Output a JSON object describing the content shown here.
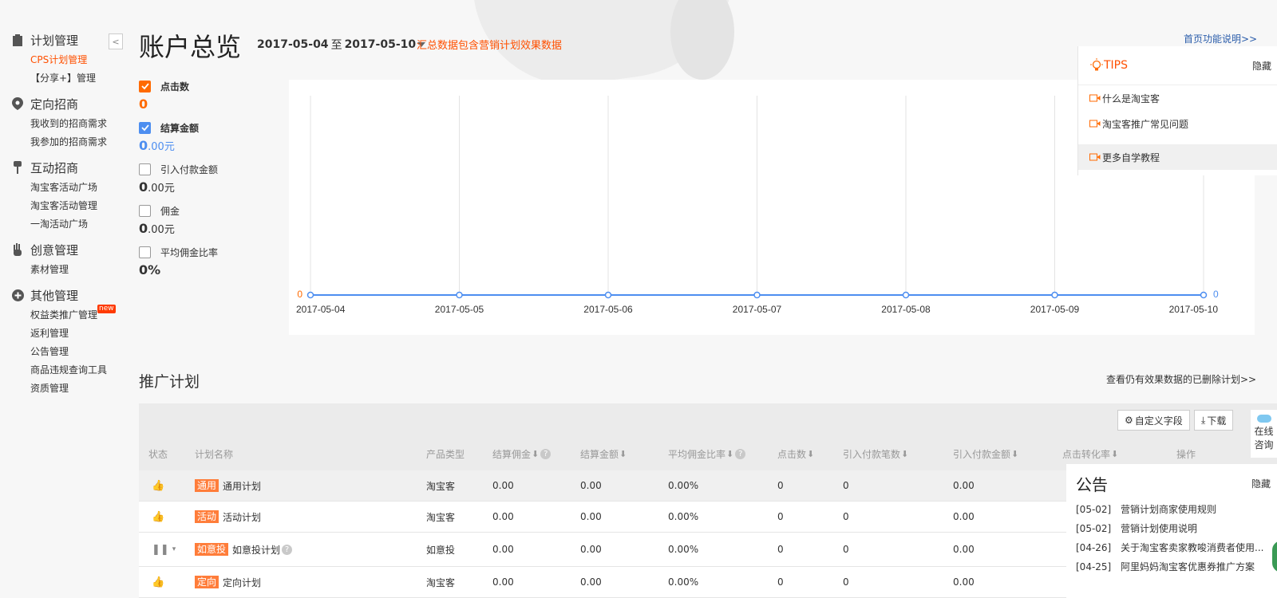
{
  "page": {
    "title": "账户总览",
    "date_from": "2017-05-04",
    "date_sep": "至",
    "date_to": "2017-05-10",
    "note": "汇总数据包含营销计划效果数据",
    "help_link": "首页功能说明>>"
  },
  "sidebar": {
    "collapse": "<",
    "sections": [
      {
        "title": "计划管理",
        "icon": "clipboard-icon",
        "items": [
          {
            "label": "CPS计划管理",
            "active": true
          },
          {
            "label": "【分享+】管理"
          }
        ]
      },
      {
        "title": "定向招商",
        "icon": "location-pin-icon",
        "items": [
          {
            "label": "我收到的招商需求"
          },
          {
            "label": "我参加的招商需求"
          }
        ]
      },
      {
        "title": "互动招商",
        "icon": "pushpin-icon",
        "items": [
          {
            "label": "淘宝客活动广场"
          },
          {
            "label": "淘宝客活动管理"
          },
          {
            "label": "一淘活动广场"
          }
        ]
      },
      {
        "title": "创意管理",
        "icon": "hand-icon",
        "items": [
          {
            "label": "素材管理"
          }
        ]
      },
      {
        "title": "其他管理",
        "icon": "plus-circle-icon",
        "items": [
          {
            "label": "权益类推广管理",
            "badge": "new"
          },
          {
            "label": "返利管理"
          },
          {
            "label": "公告管理"
          },
          {
            "label": "商品违规查询工具"
          },
          {
            "label": "资质管理"
          }
        ]
      }
    ]
  },
  "metrics": [
    {
      "label": "点击数",
      "checked": true,
      "check_color": "#ff6a00",
      "value": "0",
      "unit": "",
      "value_color": "#ff6a00",
      "bold_label": true
    },
    {
      "label": "结算金额",
      "checked": true,
      "check_color": "#4d8ef0",
      "value": "0",
      "unit": ".00元",
      "value_color": "#4d8ef0",
      "bold_label": true
    },
    {
      "label": "引入付款金额",
      "checked": false,
      "value": "0",
      "unit": ".00元",
      "value_color": "#222"
    },
    {
      "label": "佣金",
      "checked": false,
      "value": "0",
      "unit": ".00元",
      "value_color": "#222"
    },
    {
      "label": "平均佣金比率",
      "checked": false,
      "value": "0%",
      "unit": "",
      "value_color": "#222"
    }
  ],
  "chart_data": {
    "type": "line",
    "x": [
      "2017-05-04",
      "2017-05-05",
      "2017-05-06",
      "2017-05-07",
      "2017-05-08",
      "2017-05-09",
      "2017-05-10"
    ],
    "series": [
      {
        "name": "点击数",
        "values": [
          0,
          0,
          0,
          0,
          0,
          0,
          0
        ],
        "color": "#ff6a00"
      },
      {
        "name": "结算金额",
        "values": [
          0,
          0,
          0,
          0,
          0,
          0,
          0
        ],
        "color": "#4d8ef0"
      }
    ],
    "left_axis_label": "0",
    "right_axis_label": "0",
    "grid": "vertical"
  },
  "tips": {
    "title": "TIPS",
    "hide": "隐藏",
    "items": [
      {
        "label": "什么是淘宝客"
      },
      {
        "label": "淘宝客推广常见问题"
      },
      {
        "label": "更多自学教程"
      }
    ]
  },
  "plans": {
    "title": "推广计划",
    "deleted_link": "查看仍有效果数据的已删除计划>>",
    "custom_fields": "自定义字段",
    "download": "下载",
    "headers": [
      "状态",
      "计划名称",
      "产品类型",
      "结算佣金",
      "结算金额",
      "平均佣金比率",
      "点击数",
      "引入付款笔数",
      "引入付款金额",
      "点击转化率",
      "操作"
    ],
    "rows": [
      {
        "tag": "通用",
        "name": "通用计划",
        "type": "淘宝客",
        "commission": "0.00",
        "amount": "0.00",
        "rate": "0.00%",
        "clicks": "0",
        "orders": "0",
        "pay": "0.00"
      },
      {
        "tag": "活动",
        "name": "活动计划",
        "type": "淘宝客",
        "commission": "0.00",
        "amount": "0.00",
        "rate": "0.00%",
        "clicks": "0",
        "orders": "0",
        "pay": "0.00"
      },
      {
        "tag": "如意投",
        "name": "如意投计划",
        "type": "如意投",
        "commission": "0.00",
        "amount": "0.00",
        "rate": "0.00%",
        "clicks": "0",
        "orders": "0",
        "pay": "0.00"
      },
      {
        "tag": "定向",
        "name": "定向计划",
        "type": "淘宝客",
        "commission": "0.00",
        "amount": "0.00",
        "rate": "0.00%",
        "clicks": "0",
        "orders": "0",
        "pay": "0.00"
      }
    ]
  },
  "notice": {
    "title": "公告",
    "hide": "隐藏",
    "items": [
      {
        "date": "[05-02]",
        "text": "营销计划商家使用规则"
      },
      {
        "date": "[05-02]",
        "text": "营销计划使用说明"
      },
      {
        "date": "[04-26]",
        "text": "关于淘宝客卖家教唆消费者使用..."
      },
      {
        "date": "[04-25]",
        "text": "阿里妈妈淘宝客优惠券推广方案"
      }
    ]
  },
  "online": {
    "line1": "在线",
    "line2": "咨询"
  }
}
